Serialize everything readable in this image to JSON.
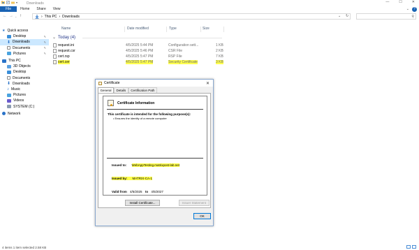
{
  "window": {
    "title": "Downloads",
    "help_label": "?"
  },
  "ribbon": {
    "tabs": [
      "File",
      "Home",
      "Share",
      "View"
    ]
  },
  "address": {
    "crumbs": [
      "This PC",
      "Downloads"
    ],
    "search_placeholder": ""
  },
  "columns": {
    "name": "Name",
    "date": "Date modified",
    "type": "Type",
    "size": "Size"
  },
  "group": {
    "label": "Today (4)"
  },
  "files": [
    {
      "name": "request.ini",
      "date": "4/5/2025 5:44 PM",
      "type": "Configuration sett...",
      "size": "1 KB"
    },
    {
      "name": "request.csr",
      "date": "4/5/2025 5:46 PM",
      "type": "CSR File",
      "size": "2 KB"
    },
    {
      "name": "cert.rsp",
      "date": "4/5/2025 5:47 PM",
      "type": "RSP File",
      "size": "7 KB"
    },
    {
      "name": "cert.cer",
      "date": "4/5/2025 5:47 PM",
      "type": "Security Certificate",
      "size": "3 KB"
    }
  ],
  "nav": {
    "quick_access": "Quick access",
    "quick_items": [
      "Desktop",
      "Downloads",
      "Documents",
      "Pictures"
    ],
    "this_pc": "This PC",
    "pc_items": [
      "3D Objects",
      "Desktop",
      "Documents",
      "Downloads",
      "Music",
      "Pictures",
      "Videos",
      "SYSTEM (C:)"
    ],
    "network": "Network"
  },
  "status": {
    "text": "4 items   1 item selected 2.58 KB"
  },
  "dialog": {
    "title": "Certificate",
    "tabs": [
      "General",
      "Details",
      "Certification Path"
    ],
    "info_title": "Certificate Information",
    "purpose_heading": "This certificate is intended for the following purpose(s):",
    "purpose_item": "Ensures the identity of a remote computer",
    "issued_to_label": "Issued to:",
    "issued_to_value": "WebAppTesting.matrixpost-lab.net",
    "issued_by_label": "Issued by:",
    "issued_by_value": "MATRIX-CA-1",
    "valid_from_label": "Valid from",
    "valid_from": "4/5/2025",
    "valid_to_label": "to",
    "valid_to": "4/5/2027",
    "install_button": "Install Certificate...",
    "issuer_button": "Issuer Statement",
    "ok_button": "OK"
  },
  "colors": {
    "accent": "#1a63b4",
    "highlight": "#ffff4d",
    "selection": "#cce8ff"
  }
}
